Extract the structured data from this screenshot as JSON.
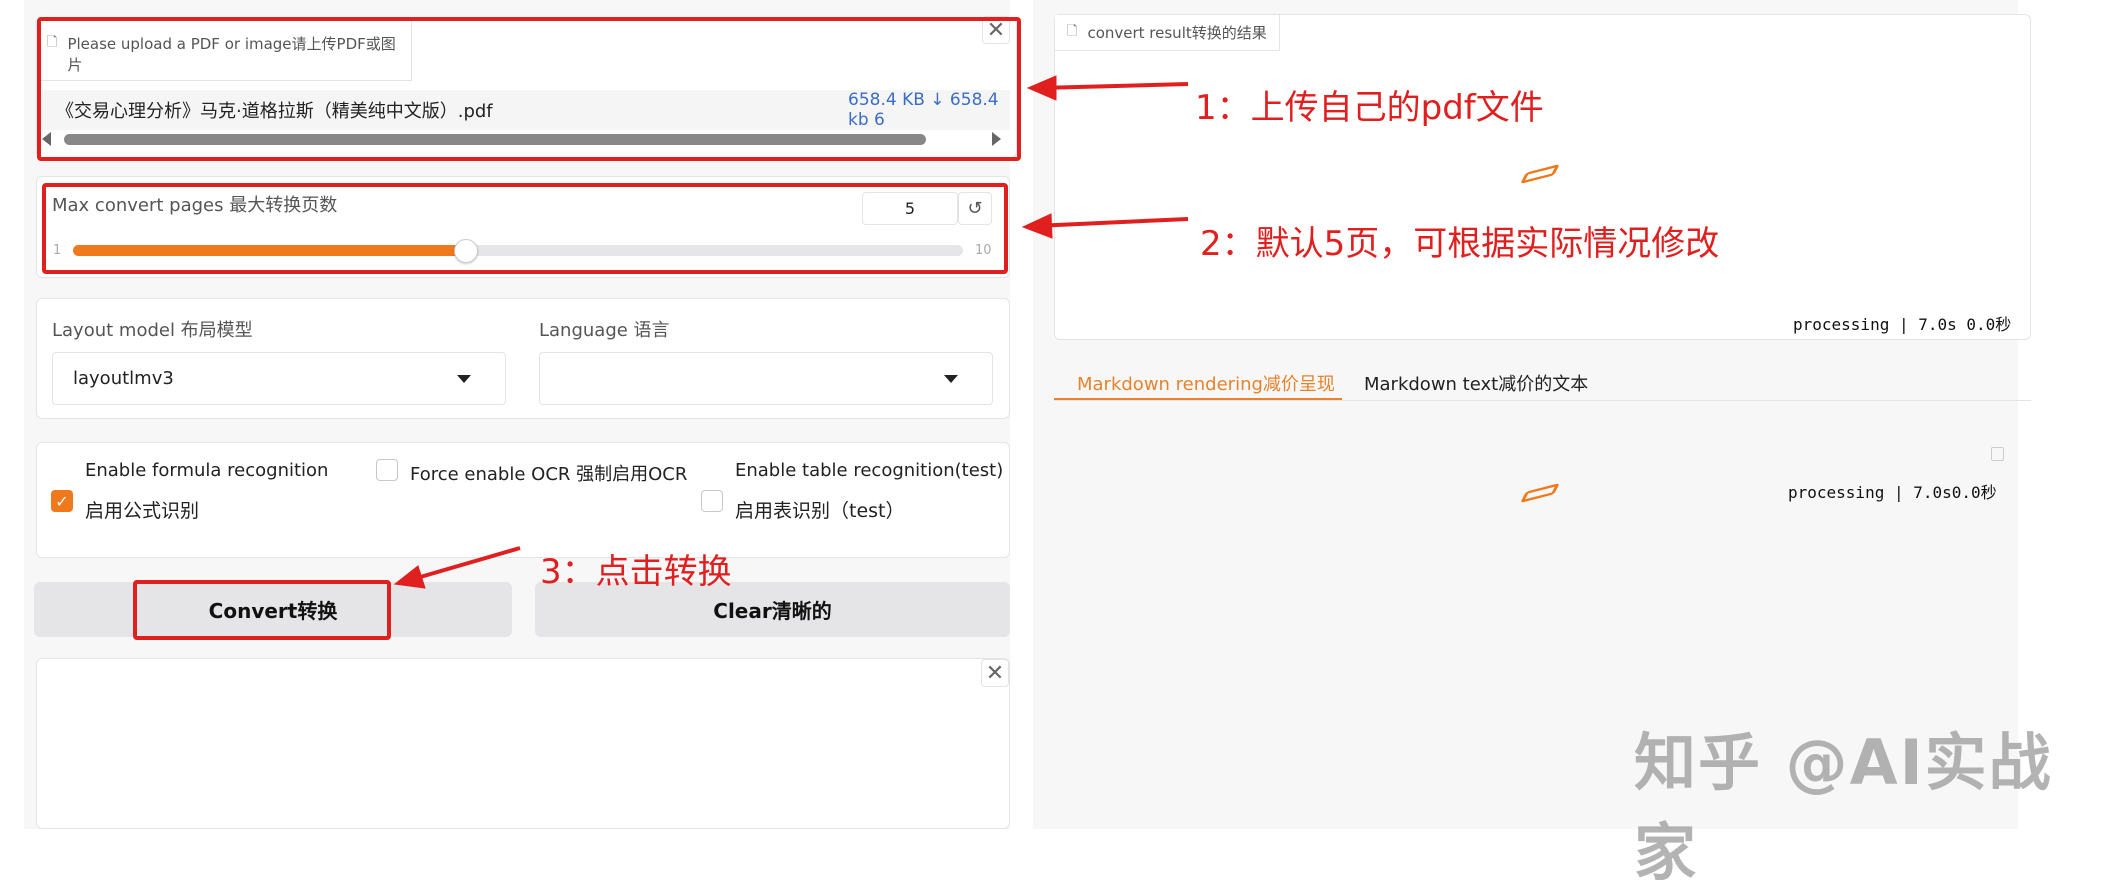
{
  "upload": {
    "label": "Please upload a PDF or image请上传PDF或图片",
    "file_name": "《交易心理分析》马克·道格拉斯（精美纯中文版）.pdf",
    "file_size": "658.4 KB ↓ 658.4 kb 6"
  },
  "max_pages": {
    "label": "Max convert pages 最大转换页数",
    "value": "5",
    "min_label": "1",
    "max_label": "10",
    "fraction": 0.44
  },
  "layout_model": {
    "label": "Layout model 布局模型",
    "value": "layoutlmv3"
  },
  "language": {
    "label": "Language 语言",
    "value": ""
  },
  "options": {
    "formula_label_en": "Enable formula recognition",
    "formula_label_zh": "启用公式识别",
    "ocr_label": "Force enable OCR 强制启用OCR",
    "table_label_en": "Enable table recognition(test)",
    "table_label_zh": "启用表识别（test）"
  },
  "buttons": {
    "convert": "Convert转换",
    "clear": "Clear清晰的"
  },
  "result": {
    "label": "convert result转换的结果",
    "status": "processing | 7.0s 0.0秒"
  },
  "tabs": [
    {
      "label": "Markdown rendering减价呈现",
      "active": true
    },
    {
      "label": "Markdown text减价的文本",
      "active": false
    }
  ],
  "markdown_status": "processing | 7.0s0.0秒",
  "annotations": {
    "a1": "1：上传自己的pdf文件",
    "a2": "2：默认5页，可根据实际情况修改",
    "a3": "3：点击转换"
  },
  "watermark": "知乎 @AI实战家",
  "colors": {
    "accent": "#f07a1b",
    "annotation": "#e01f1f",
    "link": "#3b6dc7"
  },
  "icons": [
    "file-icon",
    "close-icon",
    "reset-icon",
    "chevron-down-icon",
    "check-icon",
    "loading-icon",
    "copy-icon"
  ]
}
